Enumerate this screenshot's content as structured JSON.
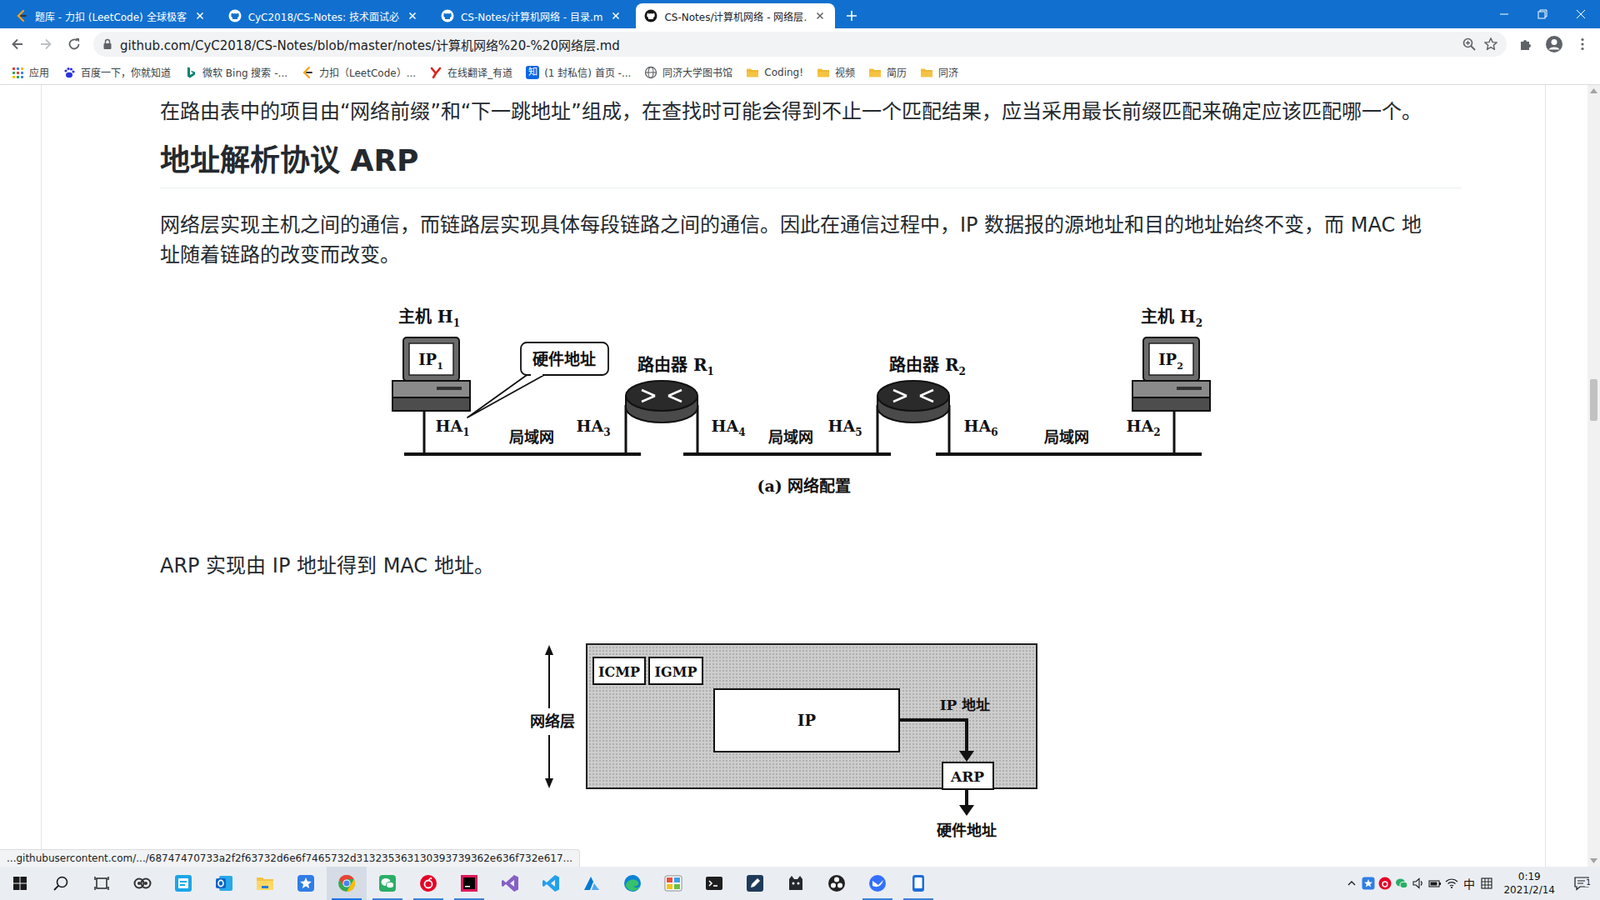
{
  "tabs": [
    {
      "label": "题库 - 力扣 (LeetCode) 全球极客",
      "kind": "leetcode",
      "selected": false
    },
    {
      "label": "CyC2018/CS-Notes: 技术面试必",
      "kind": "github",
      "selected": false
    },
    {
      "label": "CS-Notes/计算机网络 - 目录.m",
      "kind": "github",
      "selected": false
    },
    {
      "label": "CS-Notes/计算机网络 - 网络层.",
      "kind": "github",
      "selected": true
    }
  ],
  "address_bar": {
    "url": "github.com/CyC2018/CS-Notes/blob/master/notes/计算机网络%20-%20网络层.md"
  },
  "bookmarks": [
    {
      "label": "应用",
      "kind": "apps"
    },
    {
      "label": "百度一下，你就知道",
      "kind": "baidu"
    },
    {
      "label": "微软 Bing 搜索 -...",
      "kind": "bing"
    },
    {
      "label": "力扣（LeetCode）...",
      "kind": "leetcode"
    },
    {
      "label": "在线翻译_有道",
      "kind": "youdao"
    },
    {
      "label": "(1 封私信) 首页 -...",
      "kind": "zhihu",
      "badge": "知"
    },
    {
      "label": "同济大学图书馆",
      "kind": "globe"
    },
    {
      "label": "Coding!",
      "kind": "folder"
    },
    {
      "label": "视频",
      "kind": "folder"
    },
    {
      "label": "简历",
      "kind": "folder"
    },
    {
      "label": "同济",
      "kind": "folder"
    }
  ],
  "article": {
    "intro": "在路由表中的项目由“网络前缀”和“下一跳地址”组成，在查找时可能会得到不止一个匹配结果，应当采用最长前缀匹配来确定应该匹配哪一个。",
    "heading": "地址解析协议 ARP",
    "para": "网络层实现主机之间的通信，而链路层实现具体每段链路之间的通信。因此在通信过程中，IP 数据报的源地址和目的地址始终不变，而 MAC 地址随着链路的改变而改变。",
    "figure_network": {
      "hosts": [
        {
          "name": {
            "text": "主机 H",
            "sub": "1"
          },
          "ip": {
            "text": "IP",
            "sub": "1"
          },
          "ha": {
            "text": "HA",
            "sub": "1"
          }
        },
        {
          "name": {
            "text": "主机 H",
            "sub": "2"
          },
          "ip": {
            "text": "IP",
            "sub": "2"
          },
          "ha": {
            "text": "HA",
            "sub": "2"
          }
        }
      ],
      "routers": [
        {
          "name": {
            "text": "路由器 R",
            "sub": "1"
          },
          "left_ha": {
            "text": "HA",
            "sub": "3"
          },
          "right_ha": {
            "text": "HA",
            "sub": "4"
          }
        },
        {
          "name": {
            "text": "路由器 R",
            "sub": "2"
          },
          "left_ha": {
            "text": "HA",
            "sub": "5"
          },
          "right_ha": {
            "text": "HA",
            "sub": "6"
          }
        }
      ],
      "lans": [
        "局域网",
        "局域网",
        "局域网"
      ],
      "callout": "硬件地址",
      "caption": "(a) 网络配置"
    },
    "arp_sentence": "ARP 实现由 IP 地址得到 MAC 地址。",
    "figure_arp": {
      "layer_label": "网络层",
      "protocols": [
        "ICMP",
        "IGMP"
      ],
      "core": "IP",
      "arrow_label": "IP 地址",
      "resolver": "ARP",
      "output": "硬件地址"
    }
  },
  "status_bubble": "...githubusercontent.com/.../68747470733a2f2f63732d6e6f7465732d313235363130393739362e636f732e617...",
  "taskbar": {
    "apps": [
      {
        "kind": "circles",
        "running": false,
        "selected": false
      },
      {
        "kind": "teal",
        "running": false,
        "selected": false
      },
      {
        "kind": "outlook",
        "running": false,
        "selected": false
      },
      {
        "kind": "explorer",
        "running": false,
        "selected": false
      },
      {
        "kind": "star",
        "running": false,
        "selected": false
      },
      {
        "kind": "chrome",
        "running": true,
        "selected": true
      },
      {
        "kind": "wechat",
        "running": true,
        "selected": false
      },
      {
        "kind": "netease",
        "running": true,
        "selected": false
      },
      {
        "kind": "jetbrains",
        "running": true,
        "selected": false
      },
      {
        "kind": "vs",
        "running": false,
        "selected": false
      },
      {
        "kind": "vscode",
        "running": false,
        "selected": false
      },
      {
        "kind": "azure",
        "running": false,
        "selected": false
      },
      {
        "kind": "edge",
        "running": false,
        "selected": false
      },
      {
        "kind": "paint",
        "running": false,
        "selected": false
      },
      {
        "kind": "terminal",
        "running": false,
        "selected": false
      },
      {
        "kind": "pen",
        "running": false,
        "selected": false
      },
      {
        "kind": "cat",
        "running": false,
        "selected": false
      },
      {
        "kind": "obs",
        "running": false,
        "selected": false
      },
      {
        "kind": "feishu",
        "running": true,
        "selected": false
      },
      {
        "kind": "phone",
        "running": true,
        "selected": false
      }
    ],
    "tray": {
      "ime": "中",
      "time": "0:19",
      "date": "2021/2/14",
      "notifications": "1"
    }
  }
}
